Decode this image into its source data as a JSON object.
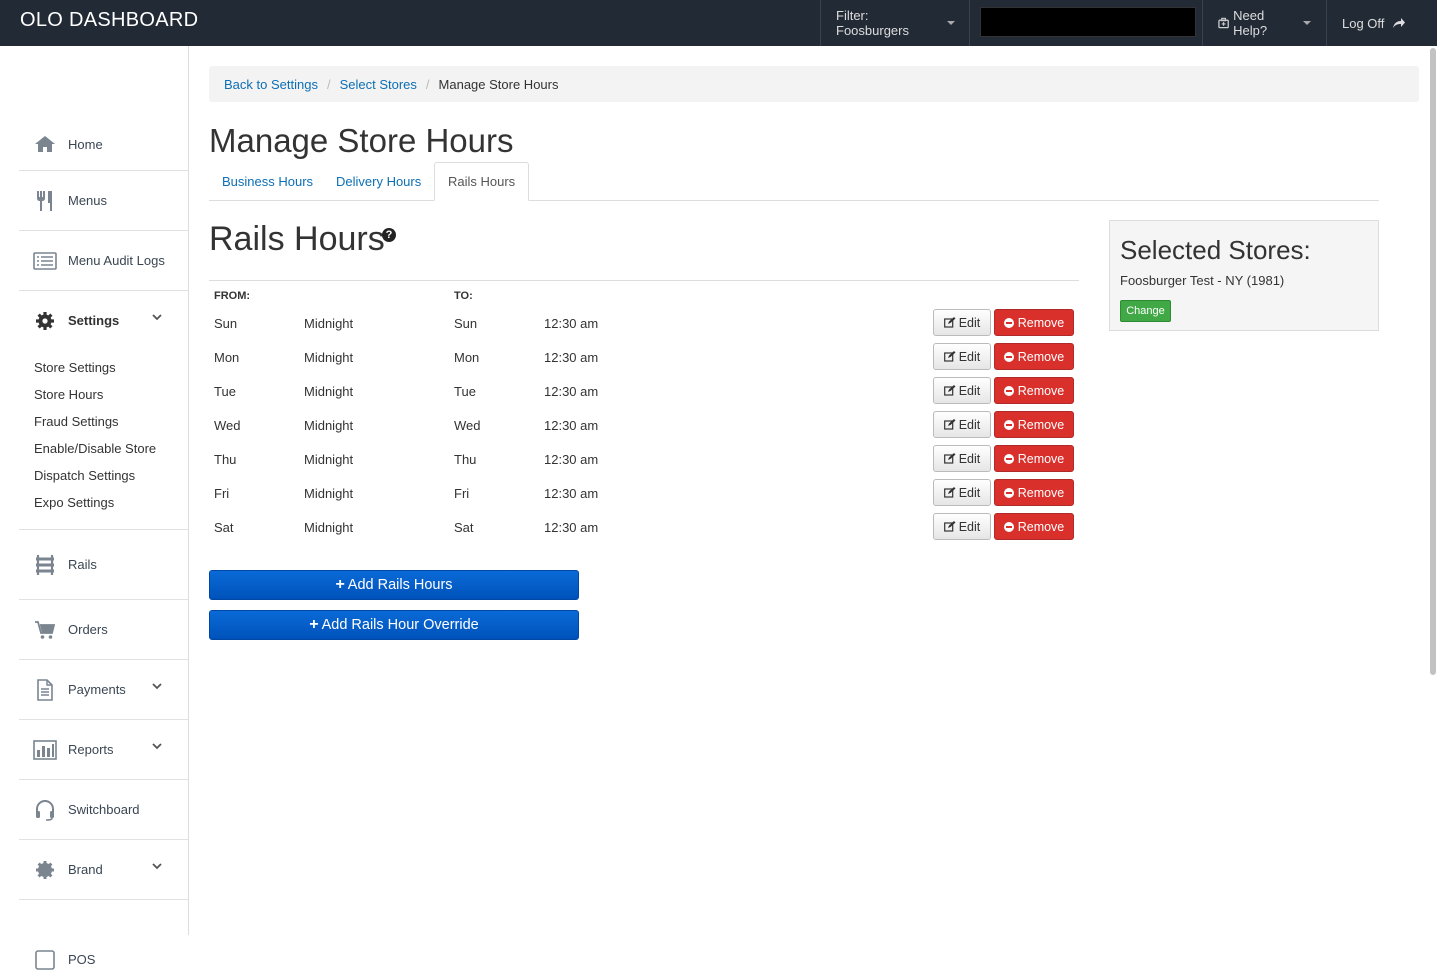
{
  "header": {
    "brand": "OLO DASHBOARD",
    "filter_label": "Filter: Foosburgers",
    "help_label": "Need Help?",
    "logoff_label": "Log Off"
  },
  "sidebar": {
    "items": [
      {
        "label": "Home",
        "icon": "home-icon"
      },
      {
        "label": "Menus",
        "icon": "utensils-icon"
      },
      {
        "label": "Menu Audit Logs",
        "icon": "list-icon"
      },
      {
        "label": "Settings",
        "icon": "gear-icon"
      },
      {
        "label": "Rails",
        "icon": "rails-icon"
      },
      {
        "label": "Orders",
        "icon": "cart-icon"
      },
      {
        "label": "Payments",
        "icon": "document-icon"
      },
      {
        "label": "Reports",
        "icon": "bar-chart-icon"
      },
      {
        "label": "Switchboard",
        "icon": "headset-icon"
      },
      {
        "label": "Brand",
        "icon": "badge-icon"
      },
      {
        "label": "POS",
        "icon": "pos-icon"
      }
    ],
    "settings_sub": [
      "Store Settings",
      "Store Hours",
      "Fraud Settings",
      "Enable/Disable Store",
      "Dispatch Settings",
      "Expo Settings"
    ]
  },
  "breadcrumb": {
    "back": "Back to Settings",
    "select": "Select Stores",
    "current": "Manage Store Hours",
    "separator": "/"
  },
  "page_title": "Manage Store Hours",
  "tabs": [
    "Business Hours",
    "Delivery Hours",
    "Rails Hours"
  ],
  "section_title": "Rails Hours",
  "help_glyph": "?",
  "table": {
    "from_header": "FROM:",
    "to_header": "TO:",
    "rows": [
      {
        "from_day": "Sun",
        "from_time": "Midnight",
        "to_day": "Sun",
        "to_time": "12:30 am"
      },
      {
        "from_day": "Mon",
        "from_time": "Midnight",
        "to_day": "Mon",
        "to_time": "12:30 am"
      },
      {
        "from_day": "Tue",
        "from_time": "Midnight",
        "to_day": "Tue",
        "to_time": "12:30 am"
      },
      {
        "from_day": "Wed",
        "from_time": "Midnight",
        "to_day": "Wed",
        "to_time": "12:30 am"
      },
      {
        "from_day": "Thu",
        "from_time": "Midnight",
        "to_day": "Thu",
        "to_time": "12:30 am"
      },
      {
        "from_day": "Fri",
        "from_time": "Midnight",
        "to_day": "Fri",
        "to_time": "12:30 am"
      },
      {
        "from_day": "Sat",
        "from_time": "Midnight",
        "to_day": "Sat",
        "to_time": "12:30 am"
      }
    ],
    "edit_label": "Edit",
    "remove_label": "Remove"
  },
  "actions": {
    "add_hours": "Add Rails Hours",
    "add_override": "Add Rails Hour Override"
  },
  "selected_stores": {
    "title": "Selected Stores:",
    "store": "Foosburger Test - NY (1981)",
    "change_label": "Change"
  },
  "colors": {
    "topbar": "#222a35",
    "link": "#0d6fb5",
    "remove": "#d9302c",
    "primary": "#0a6ad6",
    "change": "#40a845"
  }
}
